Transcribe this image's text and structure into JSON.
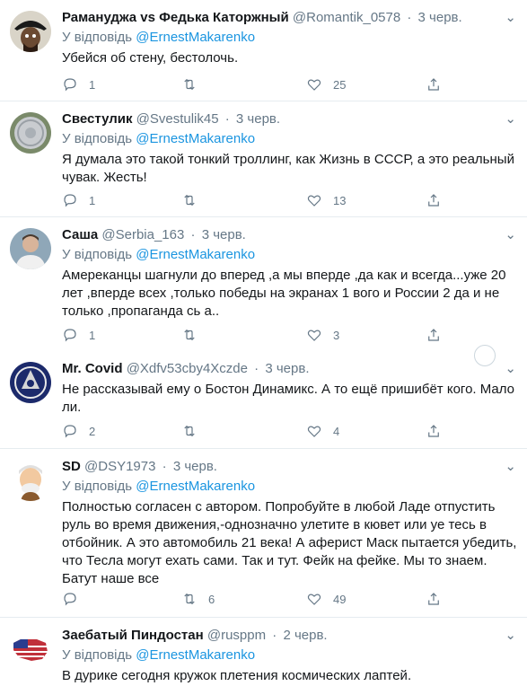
{
  "tweets": [
    {
      "name": "Рамануджа vs Федька Каторжный",
      "handle": "@Romantik_0578",
      "date": "3 черв.",
      "reply_prefix": "У відповідь",
      "reply_to": "@ErnestMakarenko",
      "text": "Убейся об стену, бестолочь.",
      "replies": "1",
      "retweets": "",
      "likes": "25",
      "avatar_icon": "pirate-skull-avatar"
    },
    {
      "name": "Свестулик",
      "handle": "@Svestulik45",
      "date": "3 черв.",
      "reply_prefix": "У відповідь",
      "reply_to": "@ErnestMakarenko",
      "text": "Я думала это такой тонкий троллинг, как Жизнь в СССР,  а это реальный чувак. Жесть!",
      "replies": "1",
      "retweets": "",
      "likes": "13",
      "avatar_icon": "silver-coin-avatar"
    },
    {
      "name": "Саша",
      "handle": "@Serbia_163",
      "date": "3 черв.",
      "reply_prefix": "У відповідь",
      "reply_to": "@ErnestMakarenko",
      "text": "Амереканцы шагнули до       вперед ,а мы вперде ,да как и всегда...уже 20 лет ,вперде всех ,только победы на экранах 1 вого и России 2 да и не только ,пропаганда сь  а..",
      "replies": "1",
      "retweets": "",
      "likes": "3",
      "avatar_icon": "man-portrait-avatar"
    },
    {
      "name": "Mr. Covid",
      "handle": "@Xdfv53cby4Xczde",
      "date": "3 черв.",
      "reply_prefix": "",
      "reply_to": "",
      "text": "Не рассказывай ему о Бостон Динамикс. А то ещё пришибёт кого. Мало ли.",
      "replies": "2",
      "retweets": "",
      "likes": "4",
      "avatar_icon": "emblem-avatar"
    },
    {
      "name": "SD",
      "handle": "@DSY1973",
      "date": "3 черв.",
      "reply_prefix": "У відповідь",
      "reply_to": "@ErnestMakarenko",
      "text": "Полностью согласен с автором. Попробуйте в любой Ладе отпустить руль во время движения,-однозначно улетите в кювет или уе    тесь в отбойник. А это автомобиль 21 века! А аферист Маск пытается убедить, что Тесла могут ехать сами. Так и тут. Фейк на фейке. Мы то знаем. Батут наше все",
      "replies": "",
      "retweets": "6",
      "likes": "49",
      "avatar_icon": "cartoon-old-man-avatar"
    },
    {
      "name": "Заебатый Пиндостан",
      "handle": "@rusppm",
      "date": "2 черв.",
      "reply_prefix": "У відповідь",
      "reply_to": "@ErnestMakarenko",
      "text": "В дурике сегодня кружок плетения космических лаптей.",
      "replies": "",
      "retweets": "",
      "likes": "",
      "avatar_icon": "us-map-flag-avatar"
    }
  ],
  "ui": {
    "dot": "·",
    "chevron": "⌄"
  },
  "colors": {
    "accent": "#1b95e0",
    "muted": "#657786",
    "divider": "#e6ecf0"
  }
}
